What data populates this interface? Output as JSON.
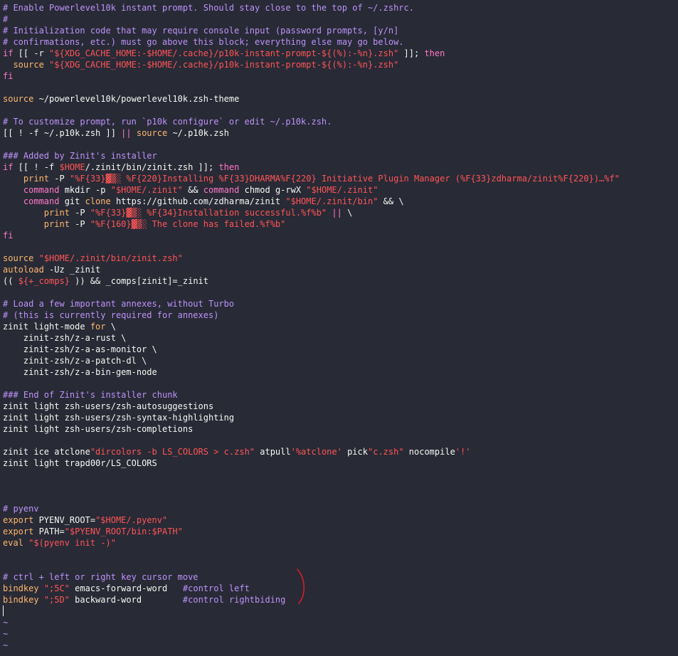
{
  "editor": {
    "colors": {
      "background": "#282a36",
      "text": "#f8f8f2",
      "comment": "#bd93f9",
      "keyword": "#ff79c6",
      "builtin": "#ffb86c",
      "string": "#ff5555",
      "annotation": "#e02020"
    },
    "lines": [
      [
        [
          "comment",
          "# Enable Powerlevel10k instant prompt. Should stay close to the top of ~/.zshrc."
        ]
      ],
      [
        [
          "comment",
          "#"
        ]
      ],
      [
        [
          "comment",
          "# Initialization code that may require console input (password prompts, [y/n]"
        ]
      ],
      [
        [
          "comment",
          "# confirmations, etc.) must go above this block; everything else may go below."
        ]
      ],
      [
        [
          "keyword",
          "if"
        ],
        [
          "plain",
          " [[ -r "
        ],
        [
          "string",
          "\"${XDG_CACHE_HOME:-$HOME/.cache}/p10k-instant-prompt-${(%):-%n}.zsh\""
        ],
        [
          "plain",
          " ]]; "
        ],
        [
          "keyword",
          "then"
        ]
      ],
      [
        [
          "plain",
          "  "
        ],
        [
          "builtin",
          "source"
        ],
        [
          "plain",
          " "
        ],
        [
          "string",
          "\"${XDG_CACHE_HOME:-$HOME/.cache}/p10k-instant-prompt-${(%):-%n}.zsh\""
        ]
      ],
      [
        [
          "keyword",
          "fi"
        ]
      ],
      [],
      [
        [
          "builtin",
          "source"
        ],
        [
          "plain",
          " ~/powerlevel10k/powerlevel10k.zsh-theme"
        ]
      ],
      [],
      [
        [
          "comment",
          "# To customize prompt, run `p10k configure` or edit ~/.p10k.zsh."
        ]
      ],
      [
        [
          "plain",
          "[[ ! -f ~/.p10k.zsh ]] "
        ],
        [
          "keyword",
          "||"
        ],
        [
          "plain",
          " "
        ],
        [
          "builtin",
          "source"
        ],
        [
          "plain",
          " ~/.p10k.zsh"
        ]
      ],
      [],
      [
        [
          "comment",
          "### Added by Zinit's installer"
        ]
      ],
      [
        [
          "keyword",
          "if"
        ],
        [
          "plain",
          " [[ ! -f "
        ],
        [
          "string",
          "$HOME"
        ],
        [
          "plain",
          "/.zinit/bin/zinit.zsh ]]; "
        ],
        [
          "keyword",
          "then"
        ]
      ],
      [
        [
          "plain",
          "    "
        ],
        [
          "builtin",
          "print"
        ],
        [
          "plain",
          " -P "
        ],
        [
          "string",
          "\"%F{33}▓▒░ %F{220}Installing %F{33}DHARMA%F{220} Initiative Plugin Manager (%F{33}zdharma/zinit%F{220})…%f\""
        ]
      ],
      [
        [
          "plain",
          "    "
        ],
        [
          "keyword",
          "command"
        ],
        [
          "plain",
          " mkdir -p "
        ],
        [
          "string",
          "\"$HOME/.zinit\""
        ],
        [
          "plain",
          " && "
        ],
        [
          "keyword",
          "command"
        ],
        [
          "plain",
          " chmod g-rwX "
        ],
        [
          "string",
          "\"$HOME/.zinit\""
        ]
      ],
      [
        [
          "plain",
          "    "
        ],
        [
          "keyword",
          "command"
        ],
        [
          "plain",
          " git "
        ],
        [
          "builtin",
          "clone"
        ],
        [
          "plain",
          " https://github.com/zdharma/zinit "
        ],
        [
          "string",
          "\"$HOME/.zinit/bin\""
        ],
        [
          "plain",
          " && \\"
        ]
      ],
      [
        [
          "plain",
          "        "
        ],
        [
          "builtin",
          "print"
        ],
        [
          "plain",
          " -P "
        ],
        [
          "string",
          "\"%F{33}▓▒░ %F{34}Installation successful.%f%b\""
        ],
        [
          "plain",
          " "
        ],
        [
          "keyword",
          "||"
        ],
        [
          "plain",
          " \\"
        ]
      ],
      [
        [
          "plain",
          "        "
        ],
        [
          "builtin",
          "print"
        ],
        [
          "plain",
          " -P "
        ],
        [
          "string",
          "\"%F{160}▓▒░ The clone has failed.%f%b\""
        ]
      ],
      [
        [
          "keyword",
          "fi"
        ]
      ],
      [],
      [
        [
          "builtin",
          "source"
        ],
        [
          "plain",
          " "
        ],
        [
          "string",
          "\"$HOME/.zinit/bin/zinit.zsh\""
        ]
      ],
      [
        [
          "builtin",
          "autoload"
        ],
        [
          "plain",
          " -Uz _zinit"
        ]
      ],
      [
        [
          "plain",
          "(( "
        ],
        [
          "string",
          "${+_comps}"
        ],
        [
          "plain",
          " )) && _comps[zinit]=_zinit"
        ]
      ],
      [],
      [
        [
          "comment",
          "# Load a few important annexes, without Turbo"
        ]
      ],
      [
        [
          "comment",
          "# (this is currently required for annexes)"
        ]
      ],
      [
        [
          "plain",
          "zinit light-mode "
        ],
        [
          "builtin",
          "for"
        ],
        [
          "plain",
          " \\"
        ]
      ],
      [
        [
          "plain",
          "    zinit-zsh/z-a-rust \\"
        ]
      ],
      [
        [
          "plain",
          "    zinit-zsh/z-a-as-monitor \\"
        ]
      ],
      [
        [
          "plain",
          "    zinit-zsh/z-a-patch-dl \\"
        ]
      ],
      [
        [
          "plain",
          "    zinit-zsh/z-a-bin-gem-node"
        ]
      ],
      [],
      [
        [
          "comment",
          "### End of Zinit's installer chunk"
        ]
      ],
      [
        [
          "plain",
          "zinit light zsh-users/zsh-autosuggestions"
        ]
      ],
      [
        [
          "plain",
          "zinit light zsh-users/zsh-syntax-highlighting"
        ]
      ],
      [
        [
          "plain",
          "zinit light zsh-users/zsh-completions"
        ]
      ],
      [],
      [
        [
          "plain",
          "zinit ice atclone"
        ],
        [
          "string",
          "\"dircolors -b LS_COLORS > c.zsh\""
        ],
        [
          "plain",
          " atpull"
        ],
        [
          "string",
          "'%atclone'"
        ],
        [
          "plain",
          " pick"
        ],
        [
          "string",
          "\"c.zsh\""
        ],
        [
          "plain",
          " nocompile"
        ],
        [
          "string",
          "'!'"
        ]
      ],
      [
        [
          "plain",
          "zinit light trapd00r/LS_COLORS"
        ]
      ],
      [],
      [],
      [],
      [
        [
          "comment",
          "# pyenv"
        ]
      ],
      [
        [
          "builtin",
          "export"
        ],
        [
          "plain",
          " PYENV_ROOT="
        ],
        [
          "string",
          "\"$HOME/.pyenv\""
        ]
      ],
      [
        [
          "builtin",
          "export"
        ],
        [
          "plain",
          " PATH="
        ],
        [
          "string",
          "\"$PYENV_ROOT/bin:$PATH\""
        ]
      ],
      [
        [
          "builtin",
          "eval"
        ],
        [
          "plain",
          " "
        ],
        [
          "string",
          "\"$(pyenv init -)\""
        ]
      ],
      [],
      [],
      [
        [
          "comment",
          "# ctrl + left or right key cursor move"
        ]
      ],
      [
        [
          "builtin",
          "bindkey"
        ],
        [
          "plain",
          " "
        ],
        [
          "string",
          "\";5C\""
        ],
        [
          "plain",
          " emacs-forward-word   "
        ],
        [
          "comment",
          "#control left"
        ]
      ],
      [
        [
          "builtin",
          "bindkey"
        ],
        [
          "plain",
          " "
        ],
        [
          "string",
          "\";5D\""
        ],
        [
          "plain",
          " backward-word        "
        ],
        [
          "comment",
          "#control rightbiding"
        ]
      ],
      [],
      [
        [
          "tilde",
          "~"
        ]
      ],
      [
        [
          "tilde",
          "~"
        ]
      ],
      [
        [
          "tilde",
          "~"
        ]
      ]
    ]
  }
}
